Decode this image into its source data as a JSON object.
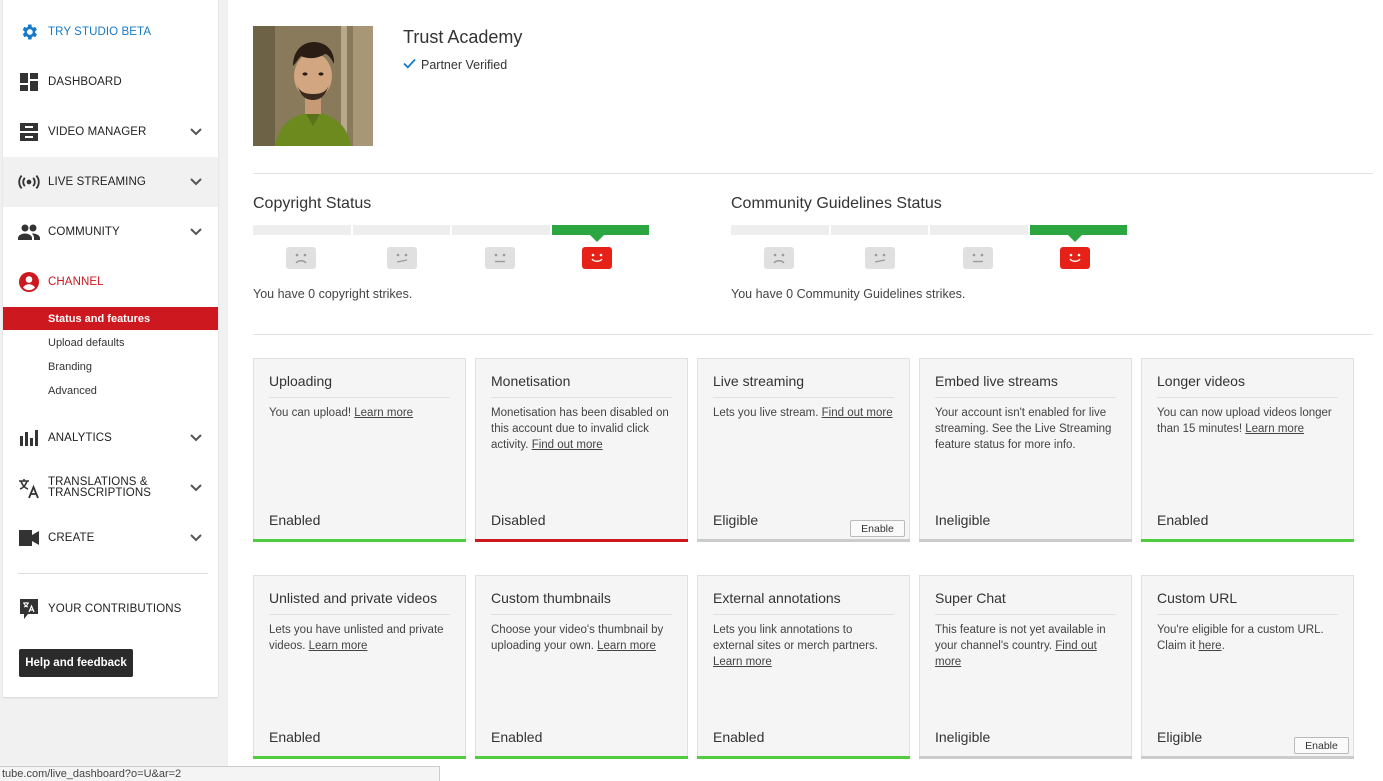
{
  "sidebar": {
    "items": [
      {
        "label": "TRY STUDIO BETA",
        "icon": "gear-icon"
      },
      {
        "label": "DASHBOARD",
        "icon": "dashboard-icon"
      },
      {
        "label": "VIDEO MANAGER",
        "icon": "video-manager-icon"
      },
      {
        "label": "LIVE STREAMING",
        "icon": "live-streaming-icon"
      },
      {
        "label": "COMMUNITY",
        "icon": "community-icon"
      },
      {
        "label": "CHANNEL",
        "icon": "channel-icon"
      },
      {
        "label": "ANALYTICS",
        "icon": "analytics-icon"
      },
      {
        "label": "TRANSLATIONS & TRANSCRIPTIONS",
        "icon": "translate-icon"
      },
      {
        "label": "CREATE",
        "icon": "create-icon"
      },
      {
        "label": "YOUR CONTRIBUTIONS",
        "icon": "contributions-icon"
      }
    ],
    "channel_subitems": [
      "Status and features",
      "Upload defaults",
      "Branding",
      "Advanced"
    ],
    "help_label": "Help and feedback"
  },
  "channel": {
    "name": "Trust Academy",
    "verified_label": "Partner Verified"
  },
  "copyright": {
    "title": "Copyright Status",
    "strikes_text": "You have 0 copyright strikes."
  },
  "community": {
    "title": "Community Guidelines Status",
    "strikes_text": "You have 0 Community Guidelines strikes."
  },
  "features": [
    {
      "title": "Uploading",
      "desc": "You can upload! ",
      "link": "Learn more",
      "state": "Enabled"
    },
    {
      "title": "Monetisation",
      "desc": "Monetisation has been disabled on this account due to invalid click activity. ",
      "link": "Find out more",
      "state": "Disabled"
    },
    {
      "title": "Live streaming",
      "desc": "Lets you live stream. ",
      "link": "Find out more",
      "state": "Eligible",
      "button": "Enable"
    },
    {
      "title": "Embed live streams",
      "desc": "Your account isn't enabled for live streaming. See the Live Streaming feature status for more info.",
      "state": "Ineligible"
    },
    {
      "title": "Longer videos",
      "desc": "You can now upload videos longer than 15 minutes! ",
      "link": "Learn more",
      "state": "Enabled"
    },
    {
      "title": "Unlisted and private videos",
      "desc": "Lets you have unlisted and private videos. ",
      "link": "Learn more",
      "state": "Enabled"
    },
    {
      "title": "Custom thumbnails",
      "desc": "Choose your video's thumbnail by uploading your own. ",
      "link": "Learn more",
      "state": "Enabled"
    },
    {
      "title": "External annotations",
      "desc": "Lets you link annotations to external sites or merch partners. ",
      "link": "Learn more",
      "state": "Enabled"
    },
    {
      "title": "Super Chat",
      "desc": "This feature is not yet available in your channel's country. ",
      "link": "Find out more",
      "state": "Ineligible"
    },
    {
      "title": "Custom URL",
      "desc": "You're eligible for a custom URL. Claim it ",
      "link": "here",
      "suffix": ".",
      "state": "Eligible",
      "button": "Enable"
    }
  ],
  "statusbar_url": "tube.com/live_dashboard?o=U&ar=2",
  "colors": {
    "red": "#cc181e",
    "blue": "#167ac6",
    "green": "#2ba640",
    "enabled_bar": "#4fcd3e"
  }
}
